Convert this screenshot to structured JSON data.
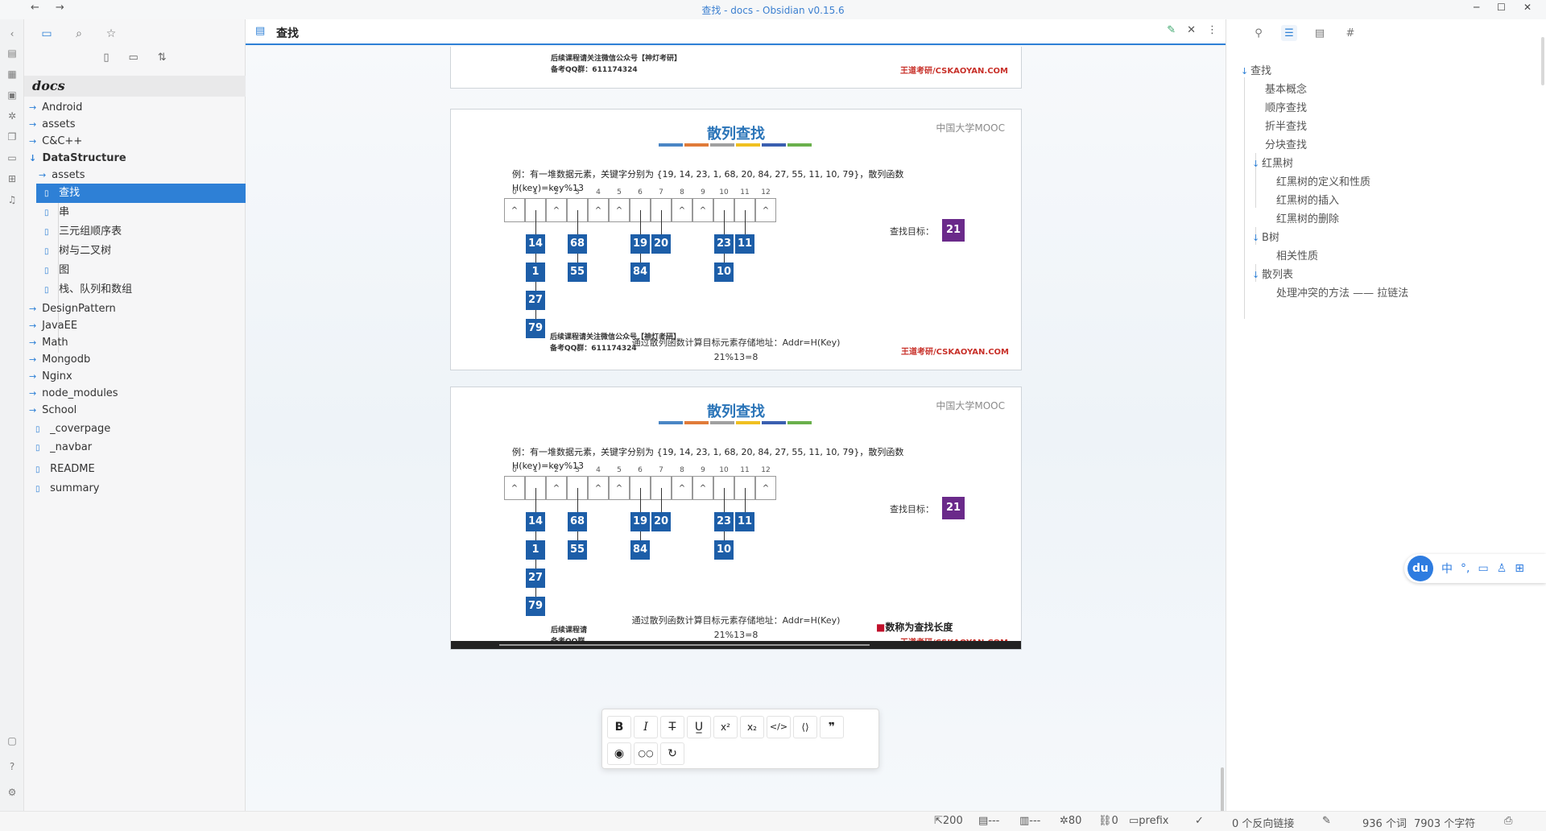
{
  "window": {
    "title": "查找 - docs - Obsidian v0.15.6",
    "back": "←",
    "forward": "→",
    "minimize": "─",
    "maximize": "☐",
    "close": "✕"
  },
  "explorer": {
    "vault_name": "docs",
    "items": [
      {
        "label": "Android",
        "type": "folder"
      },
      {
        "label": "assets",
        "type": "folder"
      },
      {
        "label": "C&C++",
        "type": "folder"
      },
      {
        "label": "DataStructure",
        "type": "folder-open"
      },
      {
        "label": "assets",
        "type": "folder"
      },
      {
        "label": "查找",
        "type": "file"
      },
      {
        "label": "串",
        "type": "file"
      },
      {
        "label": "三元组顺序表",
        "type": "file"
      },
      {
        "label": "树与二叉树",
        "type": "file"
      },
      {
        "label": "图",
        "type": "file"
      },
      {
        "label": "栈、队列和数组",
        "type": "file"
      },
      {
        "label": "DesignPattern",
        "type": "folder"
      },
      {
        "label": "JavaEE",
        "type": "folder"
      },
      {
        "label": "Math",
        "type": "folder"
      },
      {
        "label": "Mongodb",
        "type": "folder"
      },
      {
        "label": "Nginx",
        "type": "folder"
      },
      {
        "label": "node_modules",
        "type": "folder"
      },
      {
        "label": "School",
        "type": "folder"
      },
      {
        "label": "_coverpage",
        "type": "file"
      },
      {
        "label": "_navbar",
        "type": "file"
      },
      {
        "label": "README",
        "type": "file"
      },
      {
        "label": "summary",
        "type": "file"
      }
    ]
  },
  "main": {
    "tab_title": "查找",
    "slides": [
      {
        "footer_line1": "后续课程请关注微信公众号【神灯考研】",
        "footer_line2": "备考QQ群：611174324",
        "site": "王道考研/CSKAOYAN.COM"
      },
      {
        "title": "散列查找",
        "mooc": "中国大学MOOC",
        "desc": "例：有一堆数据元素，关键字分别为 {19, 14, 23, 1, 68, 20, 84, 27, 55, 11, 10, 79}，散列函数 H(key)=key%13",
        "target_label": "查找目标：",
        "target_value": "21",
        "calc_line1": "通过散列函数计算目标元素存储地址：Addr=H(Key)",
        "calc_line2": "21%13=8",
        "footer_line1": "后续课程请关注微信公众号【神灯考研】",
        "footer_line2": "备考QQ群：611174324",
        "site": "王道考研/CSKAOYAN.COM"
      },
      {
        "title": "散列查找",
        "mooc": "中国大学MOOC",
        "desc": "例：有一堆数据元素，关键字分别为 {19, 14, 23, 1, 68, 20, 84, 27, 55, 11, 10, 79}，散列函数 H(key)=key%13",
        "target_label": "查找目标：",
        "target_value": "21",
        "calc_line1": "通过散列函数计算目标元素存储地址：Addr=H(Key)",
        "calc_line2": "21%13=8",
        "footer_line1": "后续课程请",
        "footer_line2": "备考QQ群",
        "overlay_text": "数称为查找长度",
        "site": "王道考研/CSKAOYAN.COM"
      }
    ],
    "indices": [
      "0",
      "1",
      "2",
      "3",
      "4",
      "5",
      "6",
      "7",
      "8",
      "9",
      "10",
      "11",
      "12"
    ],
    "cell_mark": "^",
    "chains": {
      "1": [
        "14",
        "1",
        "27",
        "79"
      ],
      "3": [
        "68",
        "55"
      ],
      "6": [
        "19",
        "84"
      ],
      "7": [
        "20"
      ],
      "10": [
        "23",
        "10"
      ],
      "11": [
        "11"
      ]
    }
  },
  "format_toolbar": {
    "bold": "B",
    "italic": "I",
    "strikethrough": "T̶",
    "underline": "U̲",
    "superscript": "x²",
    "subscript": "x₂",
    "code": "</>",
    "codeblock": "⟨⟩",
    "quote": "❞",
    "preview": "◉",
    "reading": "○○",
    "redo": "↻"
  },
  "outline": {
    "items": [
      {
        "label": "查找",
        "level": 1,
        "collapsible": true
      },
      {
        "label": "基本概念",
        "level": 2
      },
      {
        "label": "顺序查找",
        "level": 2
      },
      {
        "label": "折半查找",
        "level": 2
      },
      {
        "label": "分块查找",
        "level": 2
      },
      {
        "label": "红黑树",
        "level": 2,
        "collapsible": true
      },
      {
        "label": "红黑树的定义和性质",
        "level": 3
      },
      {
        "label": "红黑树的插入",
        "level": 3
      },
      {
        "label": "红黑树的删除",
        "level": 3
      },
      {
        "label": "B树",
        "level": 2,
        "collapsible": true
      },
      {
        "label": "相关性质",
        "level": 3
      },
      {
        "label": "散列表",
        "level": 2,
        "collapsible": true
      },
      {
        "label": "处理冲突的方法 —— 拉链法",
        "level": 3
      }
    ]
  },
  "ime": {
    "logo": "du",
    "mode": "中",
    "punct": "°,",
    "items": [
      "▭",
      "♙",
      "⊞"
    ]
  },
  "statusbar": {
    "a": "200",
    "b": "---",
    "c": "---",
    "d": "80",
    "e": "0",
    "f": "prefix",
    "backlinks": "0 个反向链接",
    "words": "936 个词",
    "chars": "7903 个字符"
  },
  "colors": {
    "accent": "#2e80d6",
    "slide_title": "#2a74b8",
    "node": "#1d5ea8",
    "target": "#6a2a8a",
    "site_mark": "#c8312a"
  }
}
